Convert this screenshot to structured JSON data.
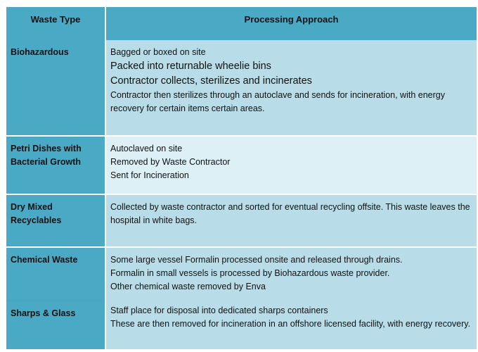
{
  "colors": {
    "header": "#4aa9c4",
    "type_column": "#4aa9c4",
    "cell": "#b8dde8",
    "cell_light": "#dcf0f5"
  },
  "headers": {
    "waste_type": "Waste Type",
    "processing": "Processing Approach"
  },
  "rows": [
    {
      "type": "Biohazardous",
      "lines": [
        "Bagged or boxed on site",
        "Packed into returnable wheelie bins",
        "Contractor collects, sterilizes and incinerates",
        "Contractor then sterilizes through an autoclave and sends for incineration, with energy recovery for certain items certain areas."
      ]
    },
    {
      "type": "Petri Dishes with Bacterial Growth",
      "lines": [
        "Autoclaved on site",
        "Removed by Waste Contractor",
        "Sent for Incineration"
      ]
    },
    {
      "type": "Dry Mixed Recyclables",
      "lines": [
        "Collected by waste contractor and sorted for eventual recycling offsite. This waste leaves the hospital in white bags."
      ]
    },
    {
      "type": "Chemical Waste",
      "lines": [
        "Some large vessel Formalin processed onsite and released through drains.",
        "Formalin in small vessels is processed by Biohazardous waste provider.",
        "Other chemical waste removed by Enva"
      ]
    },
    {
      "type": "Sharps & Glass",
      "lines": [
        "Staff place for disposal into dedicated sharps containers",
        "These are then removed for incineration in an offshore licensed facility, with energy recovery."
      ]
    }
  ]
}
